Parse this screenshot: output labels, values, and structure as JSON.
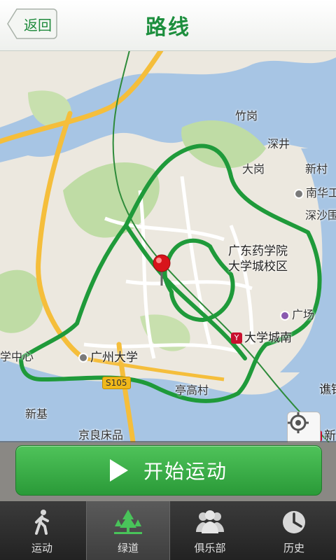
{
  "header": {
    "back_label": "返回",
    "title": "路线"
  },
  "map": {
    "labels": {
      "zhugang": "竹岗",
      "shenjing": "深井",
      "dagang": "大岗",
      "xincun": "新村",
      "nanhua": "南华工",
      "shenshawei": "深沙围",
      "gdyao": "广东药学院",
      "daxuecheng": "大学城校区",
      "guangchang": "广场",
      "metro_daxuechengnan": "大学城南",
      "gzdaxue": "广州大学",
      "xuezhongxin": "学中心",
      "yingjin": "谯锦",
      "xinji": "新基",
      "jingliang": "京良床品",
      "xinzao": "新",
      "tinghaocun": "亭高村",
      "road_shield": "S105",
      "metro_icon": "Y"
    },
    "colors": {
      "route": "#1f9a3a",
      "water": "#a7c5e4",
      "park": "#bfdca5",
      "road_major": "#f5be3b"
    }
  },
  "start_button": {
    "label": "开始运动"
  },
  "tabs": [
    {
      "label": "运动",
      "icon": "walking-person-icon"
    },
    {
      "label": "绿道",
      "icon": "trees-icon"
    },
    {
      "label": "俱乐部",
      "icon": "group-people-icon"
    },
    {
      "label": "历史",
      "icon": "clock-history-icon"
    }
  ]
}
